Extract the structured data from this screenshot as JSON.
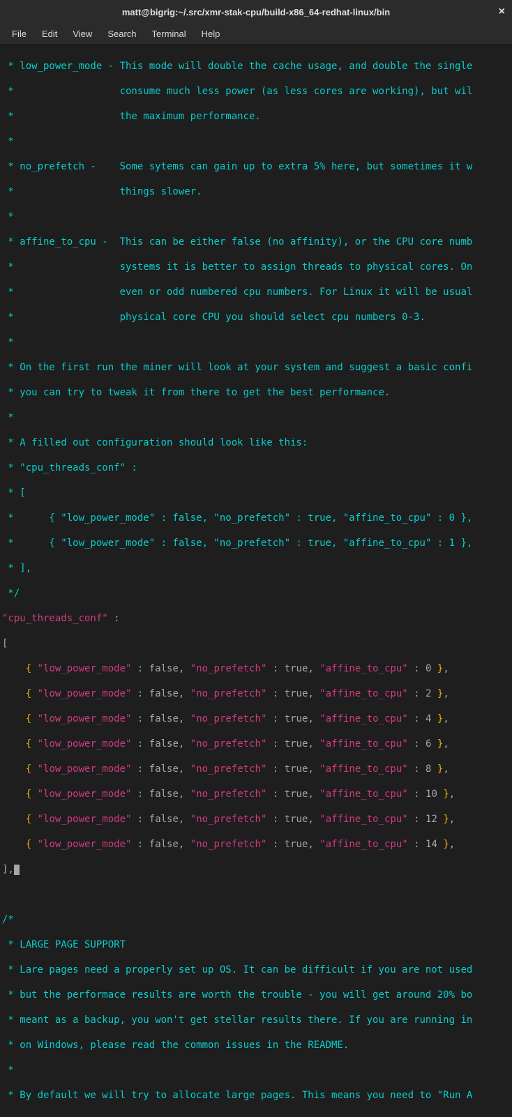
{
  "window": {
    "title": "matt@bigrig:~/.src/xmr-stak-cpu/build-x86_64-redhat-linux/bin",
    "close": "×"
  },
  "menu": {
    "file": "File",
    "edit": "Edit",
    "view": "View",
    "search": "Search",
    "terminal": "Terminal",
    "help": "Help"
  },
  "comments": {
    "c1": " * low_power_mode - This mode will double the cache usage, and double the single",
    "c2": " *                  consume much less power (as less cores are working), but wil",
    "c3": " *                  the maximum performance.",
    "c4": " *",
    "c5": " * no_prefetch -    Some sytems can gain up to extra 5% here, but sometimes it w",
    "c6": " *                  things slower.",
    "c7": " *",
    "c8": " * affine_to_cpu -  This can be either false (no affinity), or the CPU core numb",
    "c9": " *                  systems it is better to assign threads to physical cores. On",
    "c10": " *                  even or odd numbered cpu numbers. For Linux it will be usual",
    "c11": " *                  physical core CPU you should select cpu numbers 0-3.",
    "c12": " *",
    "c13": " * On the first run the miner will look at your system and suggest a basic confi",
    "c14": " * you can try to tweak it from there to get the best performance.",
    "c15": " *",
    "c16": " * A filled out configuration should look like this:",
    "c17": " * \"cpu_threads_conf\" :",
    "c18": " * [",
    "c19": " *      { \"low_power_mode\" : false, \"no_prefetch\" : true, \"affine_to_cpu\" : 0 },",
    "c20": " *      { \"low_power_mode\" : false, \"no_prefetch\" : true, \"affine_to_cpu\" : 1 },",
    "c21": " * ],",
    "c22": " */"
  },
  "config": {
    "header_key": "\"cpu_threads_conf\"",
    "colon": " :",
    "open": "[",
    "close": "]",
    "comma": ",",
    "lpm_key": "\"low_power_mode\"",
    "np_key": "\"no_prefetch\"",
    "atc_key": "\"affine_to_cpu\"",
    "false": "false",
    "true": "true",
    "threads": {
      "t0": "0",
      "t1": "2",
      "t2": "4",
      "t3": "6",
      "t4": "8",
      "t5": "10",
      "t6": "12",
      "t7": "14"
    }
  },
  "large_pages": {
    "l1": "/*",
    "l2": " * LARGE PAGE SUPPORT",
    "l3": " * Lare pages need a properly set up OS. It can be difficult if you are not used",
    "l4": " * but the performace results are worth the trouble - you will get around 20% bo",
    "l5": " * meant as a backup, you won't get stellar results there. If you are running in",
    "l6": " * on Windows, please read the common issues in the README.",
    "l7": " *",
    "l8": " * By default we will try to allocate large pages. This means you need to \"Run A"
  }
}
